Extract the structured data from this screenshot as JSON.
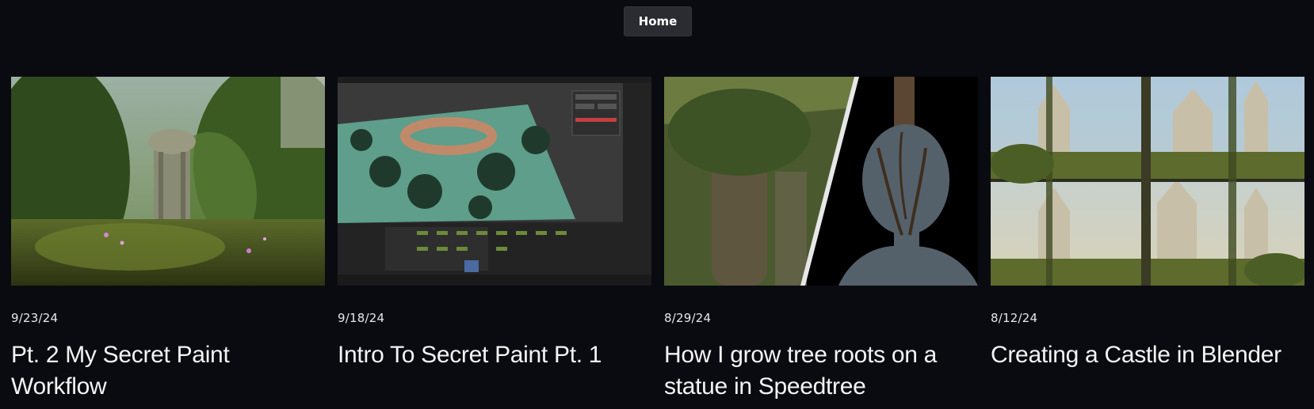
{
  "nav": {
    "home_label": "Home"
  },
  "posts": [
    {
      "date": "9/23/24",
      "title": "Pt. 2 My Secret Paint Workflow",
      "image": "forest-gazebo-render"
    },
    {
      "date": "9/18/24",
      "title": "Intro To Secret Paint Pt. 1",
      "image": "blender-viewport-screenshot"
    },
    {
      "date": "8/29/24",
      "title": "How I grow tree roots on a statue in Speedtree",
      "image": "tree-roots-statue-render"
    },
    {
      "date": "8/12/24",
      "title": "Creating a Castle in Blender",
      "image": "castle-grid-render"
    }
  ]
}
